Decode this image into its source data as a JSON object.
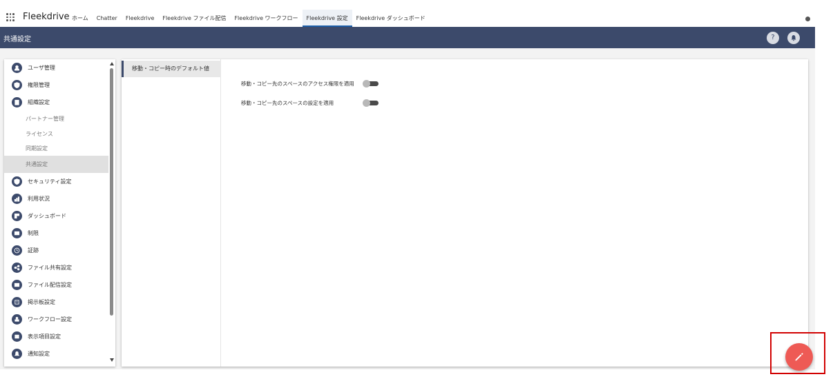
{
  "app": {
    "name": "Fleekdrive"
  },
  "nav": {
    "tabs": [
      {
        "label": "ホーム",
        "active": false
      },
      {
        "label": "Chatter",
        "active": false
      },
      {
        "label": "Fleekdrive",
        "active": false
      },
      {
        "label": "Fleekdrive ファイル配信",
        "active": false
      },
      {
        "label": "Fleekdrive ワークフロー",
        "active": false
      },
      {
        "label": "Fleekdrive 設定",
        "active": true
      },
      {
        "label": "Fleekdrive ダッシュボード",
        "active": false
      }
    ]
  },
  "header": {
    "title": "共通設定",
    "help_label": "?",
    "colors": {
      "bar": "#3c4a6b"
    }
  },
  "sidebar": {
    "items": [
      {
        "label": "ユーザ管理",
        "icon": "user-icon"
      },
      {
        "label": "権限管理",
        "icon": "shield-check-icon"
      },
      {
        "label": "組織設定",
        "icon": "building-icon"
      },
      {
        "label": "パートナー管理",
        "icon": null,
        "sub": true
      },
      {
        "label": "ライセンス",
        "icon": null,
        "sub": true
      },
      {
        "label": "同期設定",
        "icon": null,
        "sub": true
      },
      {
        "label": "共通設定",
        "icon": null,
        "sub": true,
        "selected": true
      },
      {
        "label": "セキュリティ設定",
        "icon": "security-shield-icon"
      },
      {
        "label": "利用状況",
        "icon": "usage-chart-icon"
      },
      {
        "label": "ダッシュボード",
        "icon": "dashboard-icon"
      },
      {
        "label": "制限",
        "icon": "limit-icon"
      },
      {
        "label": "証跡",
        "icon": "clock-icon"
      },
      {
        "label": "ファイル共有設定",
        "icon": "share-icon"
      },
      {
        "label": "ファイル配信設定",
        "icon": "mail-icon"
      },
      {
        "label": "掲示板設定",
        "icon": "board-icon"
      },
      {
        "label": "ワークフロー設定",
        "icon": "workflow-icon"
      },
      {
        "label": "表示項目設定",
        "icon": "list-icon"
      },
      {
        "label": "通知設定",
        "icon": "bell-icon"
      }
    ]
  },
  "main": {
    "subnav_label": "移動・コピー時のデフォルト値",
    "settings": [
      {
        "label": "移動・コピー先のスペースのアクセス権限を適用",
        "enabled": false
      },
      {
        "label": "移動・コピー先のスペースの設定を適用",
        "enabled": false
      }
    ]
  },
  "fab": {
    "icon": "pencil-icon",
    "color": "#ee5a55"
  },
  "highlight": {
    "color": "#d10000"
  }
}
